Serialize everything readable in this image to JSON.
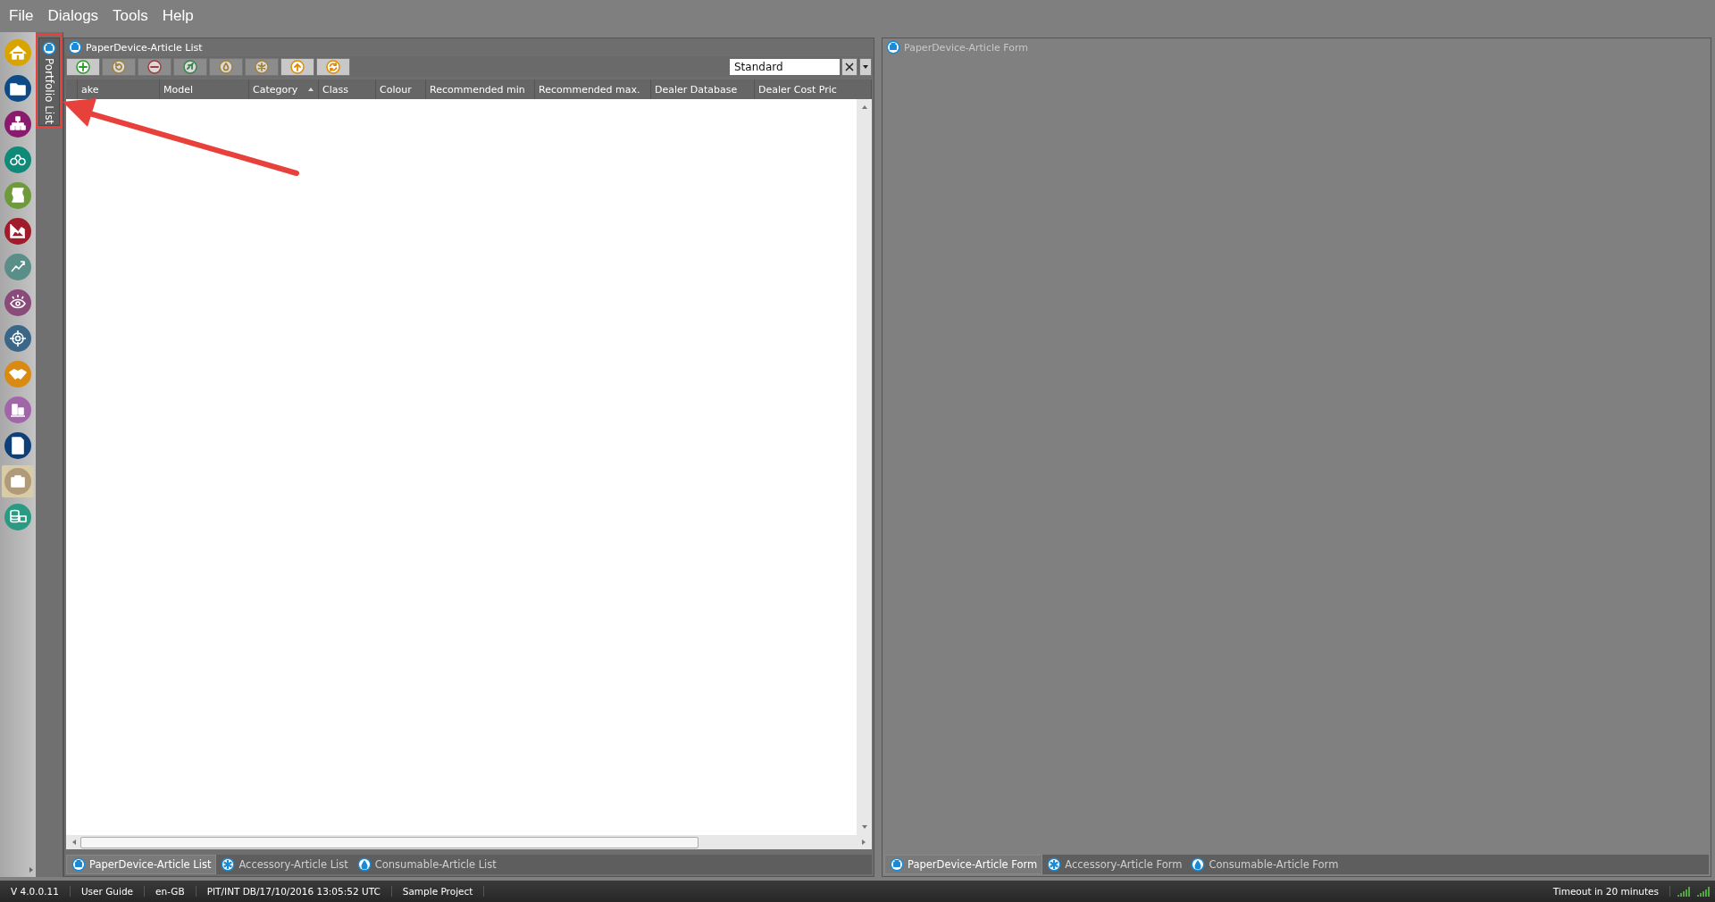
{
  "menu": [
    "File",
    "Dialogs",
    "Tools",
    "Help"
  ],
  "sidebar": {
    "items": [
      {
        "kind": "home",
        "color": "#d9a400",
        "selected": false
      },
      {
        "kind": "folder",
        "color": "#0e4a86",
        "selected": false
      },
      {
        "kind": "hierarchy",
        "color": "#8a1a6e",
        "selected": false
      },
      {
        "kind": "binoculars",
        "color": "#0f8a78",
        "selected": false
      },
      {
        "kind": "scroll",
        "color": "#6e9a3a",
        "selected": false
      },
      {
        "kind": "area-chart",
        "color": "#a01c2a",
        "selected": false
      },
      {
        "kind": "trend",
        "color": "#5a8e88",
        "selected": false
      },
      {
        "kind": "eye",
        "color": "#8a4a7a",
        "selected": false
      },
      {
        "kind": "target",
        "color": "#3a6688",
        "selected": false
      },
      {
        "kind": "handshake",
        "color": "#d98a10",
        "selected": false
      },
      {
        "kind": "bars",
        "color": "#a066a8",
        "selected": false
      },
      {
        "kind": "document",
        "color": "#0e3f78",
        "selected": false
      },
      {
        "kind": "briefcase",
        "color": "#b09a78",
        "selected": true
      },
      {
        "kind": "database",
        "color": "#2a9a82",
        "selected": false
      }
    ]
  },
  "portfolio_tab": {
    "label": "Portfolio List"
  },
  "list_panel": {
    "title": "PaperDevice-Article List",
    "toolbar": [
      {
        "kind": "add",
        "disabled": false
      },
      {
        "kind": "undo",
        "disabled": true
      },
      {
        "kind": "remove",
        "disabled": true
      },
      {
        "kind": "link",
        "disabled": true
      },
      {
        "kind": "drop",
        "disabled": true
      },
      {
        "kind": "asterisk",
        "disabled": true
      },
      {
        "kind": "upload",
        "disabled": false
      },
      {
        "kind": "refresh",
        "disabled": false
      }
    ],
    "view_select": {
      "value": "Standard"
    },
    "table": {
      "columns": [
        {
          "label": "ake",
          "sorted": false
        },
        {
          "label": "Model",
          "sorted": false
        },
        {
          "label": "Category",
          "sorted": true
        },
        {
          "label": "Class",
          "sorted": false
        },
        {
          "label": "Colour",
          "sorted": false
        },
        {
          "label": "Recommended min",
          "sorted": false
        },
        {
          "label": "Recommended max.",
          "sorted": false
        },
        {
          "label": "Dealer Database",
          "sorted": false
        },
        {
          "label": "Dealer Cost Pric",
          "sorted": false
        }
      ]
    },
    "tabs": [
      {
        "label": "PaperDevice-Article List",
        "kind": "printer",
        "selected": true
      },
      {
        "label": "Accessory-Article List",
        "kind": "asterisk",
        "selected": false
      },
      {
        "label": "Consumable-Article List",
        "kind": "drop",
        "selected": false
      }
    ]
  },
  "form_panel": {
    "title": "PaperDevice-Article Form",
    "tabs": [
      {
        "label": "PaperDevice-Article Form",
        "kind": "printer",
        "selected": true
      },
      {
        "label": "Accessory-Article Form",
        "kind": "asterisk",
        "selected": false
      },
      {
        "label": "Consumable-Article Form",
        "kind": "drop",
        "selected": false
      }
    ]
  },
  "status_bar": {
    "items": [
      "V 4.0.0.11",
      "User Guide",
      "en-GB",
      "PIT/INT DB/17/10/2016 13:05:52 UTC",
      "Sample Project"
    ],
    "timeout": "Timeout in 20 minutes"
  },
  "annotations": {
    "highlight_box": true,
    "arrow": true
  }
}
